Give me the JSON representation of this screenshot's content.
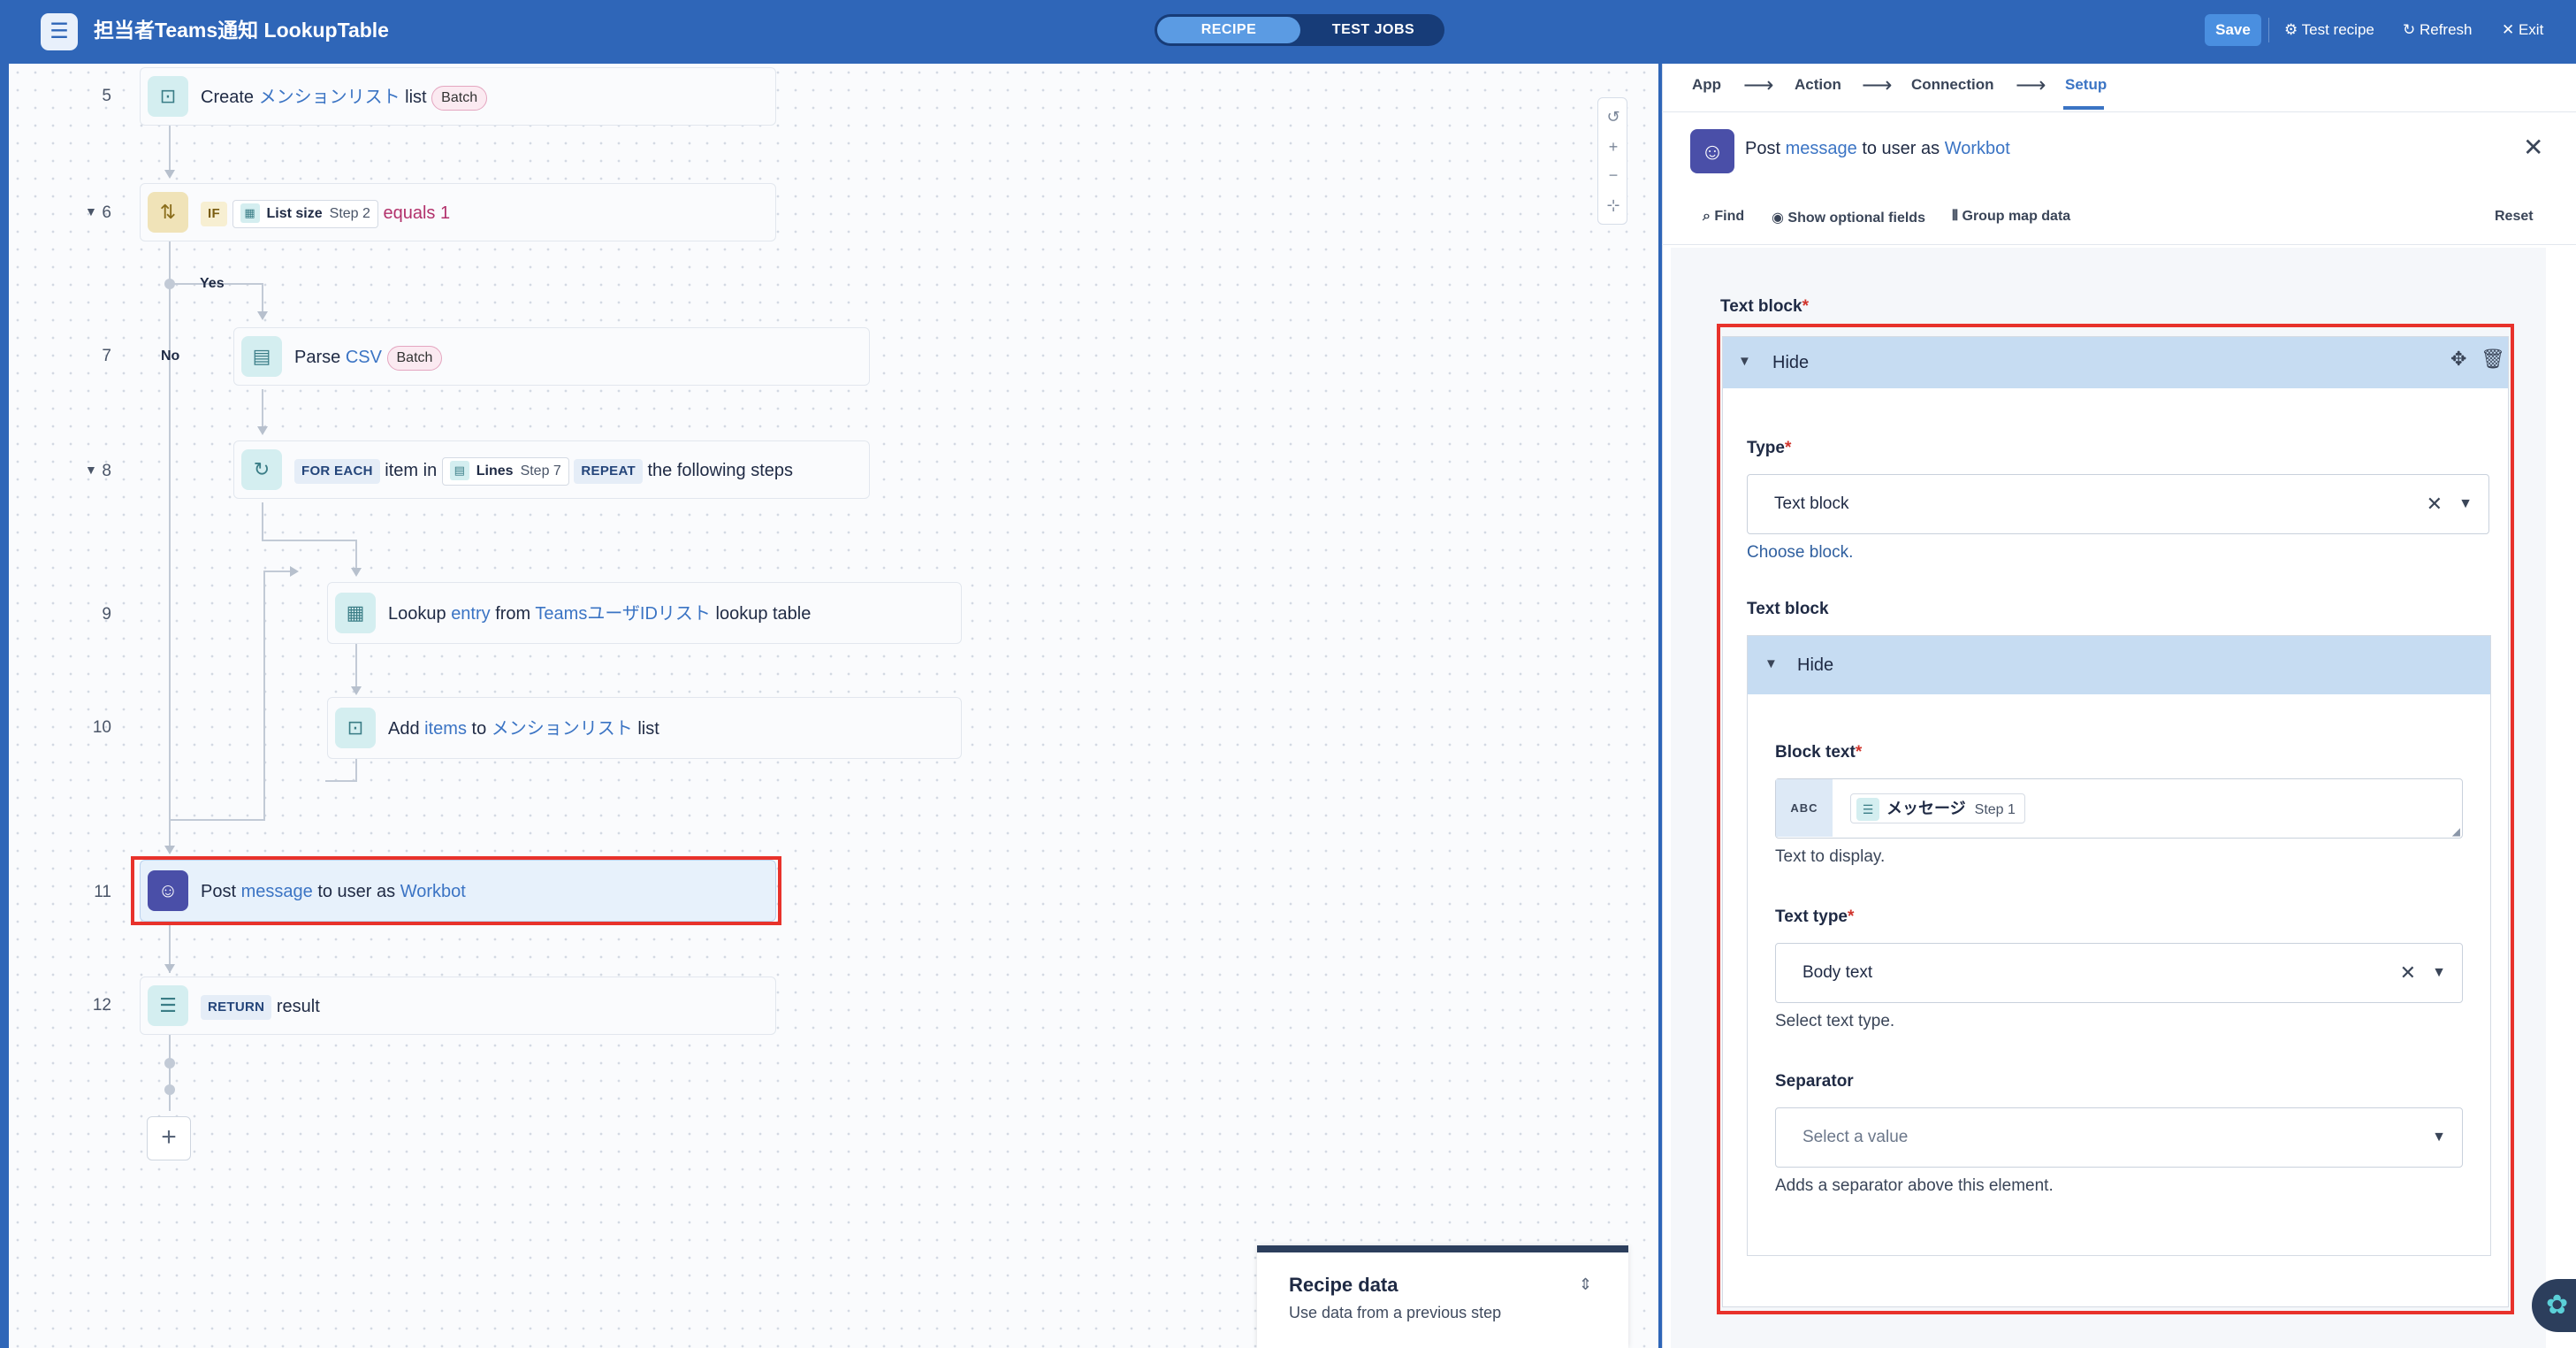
{
  "app": {
    "title": "担当者Teams通知 LookupTable"
  },
  "mode_tabs": {
    "recipe": "RECIPE",
    "test_jobs": "TEST JOBS"
  },
  "toolbar": {
    "save": "Save",
    "test_recipe": "⚙ Test recipe",
    "refresh": "↻ Refresh",
    "exit": "✕ Exit"
  },
  "steps": {
    "s5": {
      "num": "5",
      "create": "Create",
      "list_name": "メンションリスト",
      "list": "list",
      "badge": "Batch"
    },
    "s6": {
      "num": "6",
      "if": "IF",
      "field": "List size",
      "step": "Step 2",
      "op": "equals 1",
      "yes": "Yes",
      "no": "No"
    },
    "s7": {
      "num": "7",
      "parse": "Parse",
      "csv": "CSV",
      "badge": "Batch"
    },
    "s8": {
      "num": "8",
      "foreach": "FOR EACH",
      "item_in": "item in",
      "field": "Lines",
      "step": "Step 7",
      "repeat": "REPEAT",
      "rest": "the following steps"
    },
    "s9": {
      "num": "9",
      "lookup": "Lookup",
      "entry": "entry",
      "from": "from",
      "table": "TeamsユーザIDリスト",
      "suffix": "lookup table"
    },
    "s10": {
      "num": "10",
      "add": "Add",
      "items": "items",
      "to": "to",
      "list_name": "メンションリスト",
      "list": "list"
    },
    "s11": {
      "num": "11",
      "post": "Post",
      "message": "message",
      "to_user_as": "to user as",
      "app": "Workbot"
    },
    "s12": {
      "num": "12",
      "return": "RETURN",
      "result": "result"
    }
  },
  "recipe_data": {
    "title": "Recipe data",
    "subtitle": "Use data from a previous step"
  },
  "panel": {
    "crumbs": [
      "App",
      "Action",
      "Connection",
      "Setup"
    ],
    "header": {
      "post": "Post",
      "message": "message",
      "to_user_as": "to user as",
      "app": "Workbot"
    },
    "tools": {
      "find": "Find",
      "optional": "Show optional fields",
      "group": "Group map data",
      "reset": "Reset"
    },
    "text_block_label": "Text block",
    "hide": "Hide",
    "type_label": "Type",
    "type_value": "Text block",
    "type_hint": "Choose block.",
    "inner_label": "Text block",
    "block_text_label": "Block text",
    "abc": "ABC",
    "pill_field": "メッセージ",
    "pill_step": "Step 1",
    "block_text_hint": "Text to display.",
    "text_type_label": "Text type",
    "text_type_value": "Body text",
    "text_type_hint": "Select text type.",
    "separator_label": "Separator",
    "separator_placeholder": "Select a value",
    "separator_hint": "Adds a separator above this element."
  }
}
